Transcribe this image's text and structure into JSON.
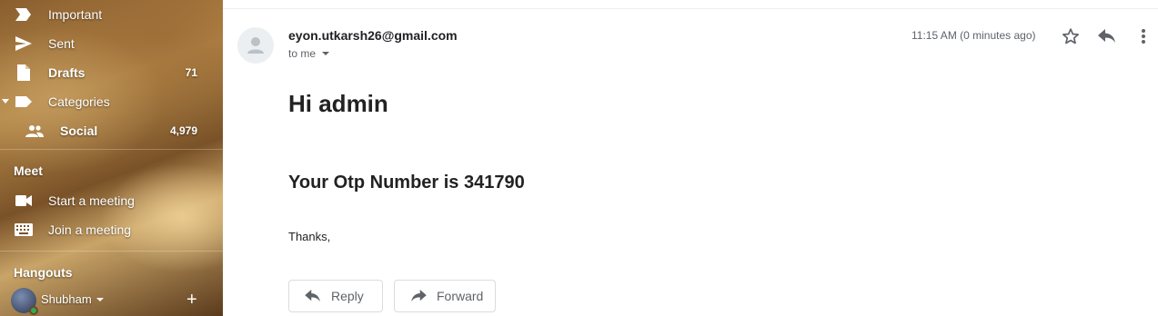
{
  "sidebar": {
    "items": [
      {
        "label": "Important",
        "count": "",
        "icon": "important-icon"
      },
      {
        "label": "Sent",
        "count": "",
        "icon": "send-icon"
      },
      {
        "label": "Drafts",
        "count": "71",
        "icon": "draft-icon"
      },
      {
        "label": "Categories",
        "count": "",
        "icon": "label-icon"
      },
      {
        "label": "Social",
        "count": "4,979",
        "icon": "people-icon"
      }
    ],
    "meet": {
      "title": "Meet",
      "start": "Start a meeting",
      "join": "Join a meeting"
    },
    "hangouts": {
      "title": "Hangouts",
      "user": "Shubham",
      "status_color": "#34a853"
    }
  },
  "message": {
    "sender": "eyon.utkarsh26@gmail.com",
    "recipient": "to me",
    "time": "11:15 AM (0 minutes ago)",
    "greeting": "Hi admin",
    "otp_line": "Your Otp Number is 341790",
    "closing": "Thanks,"
  },
  "actions": {
    "reply": "Reply",
    "forward": "Forward"
  }
}
